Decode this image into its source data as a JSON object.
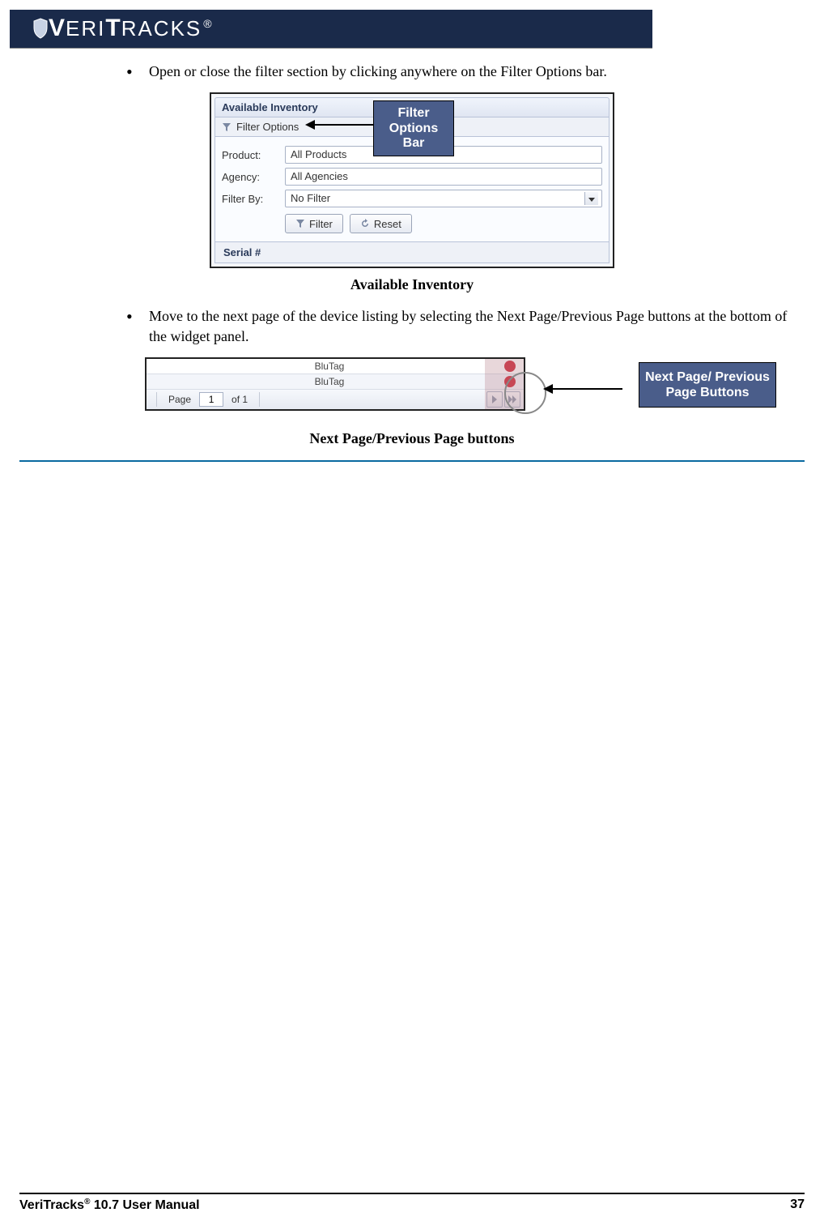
{
  "brand": {
    "name_a": "V",
    "name_b": "ERI",
    "name_c": "T",
    "name_d": "RACKS",
    "reg": "®"
  },
  "bullets": {
    "b1": "Open or close the filter section by clicking anywhere on the Filter Options bar.",
    "b2": "Move to the next page of the device listing by selecting the Next Page/Previous Page buttons at the bottom of the widget panel."
  },
  "shot1": {
    "panel_title": "Available Inventory",
    "filter_options_label": "Filter Options",
    "rows": {
      "product_label": "Product:",
      "product_value": "All Products",
      "agency_label": "Agency:",
      "agency_value": "All Agencies",
      "filterby_label": "Filter By:",
      "filterby_value": "No Filter"
    },
    "buttons": {
      "filter": "Filter",
      "reset": "Reset"
    },
    "col_header": "Serial #",
    "callout": "Filter Options Bar"
  },
  "captions": {
    "c1": "Available Inventory",
    "c2": "Next Page/Previous Page buttons"
  },
  "shot2": {
    "row1": "BluTag",
    "row2": "BluTag",
    "page_label_a": "Page",
    "page_value": "1",
    "page_label_b": "of 1",
    "callout": "Next Page/ Previous Page Buttons"
  },
  "footer": {
    "left_a": "VeriTracks",
    "left_sup": "®",
    "left_b": " 10.7 User Manual",
    "right": "37"
  }
}
